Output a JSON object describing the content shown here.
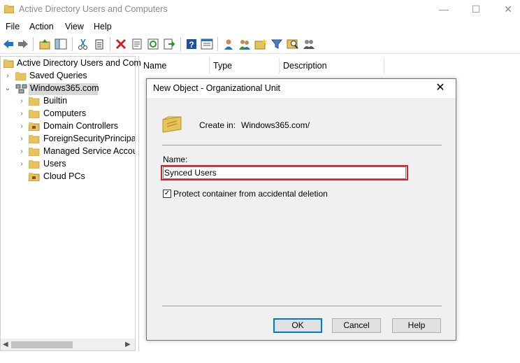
{
  "window": {
    "title": "Active Directory Users and Computers",
    "minimize": "—",
    "maximize": "☐",
    "close": "✕"
  },
  "menu": [
    "File",
    "Action",
    "View",
    "Help"
  ],
  "toolbar_icons": [
    "back-arrow-icon",
    "forward-arrow-icon",
    "up-folder-icon",
    "show-hide-console-tree-icon",
    "cut-icon",
    "copy-icon",
    "delete-icon",
    "properties-icon",
    "refresh-icon",
    "export-list-icon",
    "help-icon",
    "show-action-pane-icon",
    "new-user-icon",
    "new-group-icon",
    "new-ou-icon",
    "filter-icon",
    "find-icon",
    "add-to-group-icon"
  ],
  "tree": {
    "root": "Active Directory Users and Com",
    "saved_queries": "Saved Queries",
    "domain": "Windows365.com",
    "children": [
      "Builtin",
      "Computers",
      "Domain Controllers",
      "ForeignSecurityPrincipals",
      "Managed Service Accour",
      "Users",
      "Cloud PCs"
    ]
  },
  "columns": [
    "Name",
    "Type",
    "Description"
  ],
  "dialog": {
    "title": "New Object - Organizational Unit",
    "close": "✕",
    "create_in_label": "Create in:",
    "create_in_value": "Windows365.com/",
    "name_label": "Name:",
    "name_value": "Synced Users",
    "protect_label": "Protect container from accidental deletion",
    "protect_checked": true,
    "ok": "OK",
    "cancel": "Cancel",
    "help": "Help"
  },
  "colors": {
    "highlight": "#e01e2a",
    "folder": "#e8c25a",
    "default_button_border": "#0078d7"
  }
}
